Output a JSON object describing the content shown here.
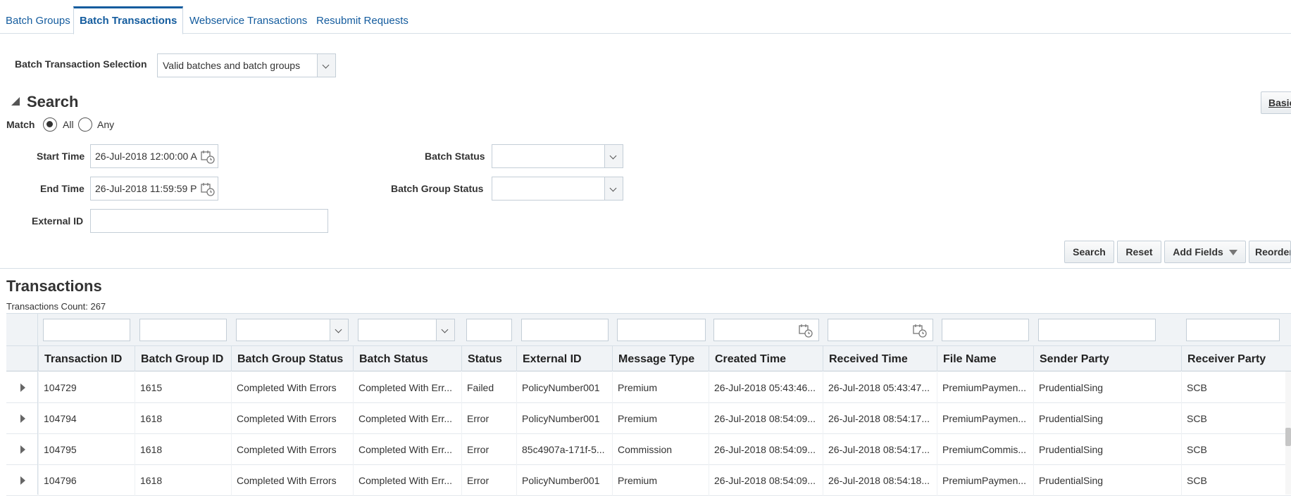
{
  "tabs": [
    {
      "label": "Batch Groups"
    },
    {
      "label": "Batch Transactions"
    },
    {
      "label": "Webservice Transactions"
    },
    {
      "label": "Resubmit Requests"
    }
  ],
  "selection": {
    "label": "Batch Transaction Selection",
    "value": "Valid batches and batch groups"
  },
  "search": {
    "title": "Search",
    "basic_label": "Basic",
    "match_label": "Match",
    "match_all": "All",
    "match_any": "Any",
    "start_time_label": "Start Time",
    "start_time_value": "26-Jul-2018 12:00:00 A",
    "end_time_label": "End Time",
    "end_time_value": "26-Jul-2018 11:59:59 P",
    "external_id_label": "External ID",
    "batch_status_label": "Batch Status",
    "batch_group_status_label": "Batch Group Status",
    "buttons": {
      "search": "Search",
      "reset": "Reset",
      "add_fields": "Add Fields",
      "reorder": "Reorder"
    }
  },
  "transactions": {
    "title": "Transactions",
    "count_text": "Transactions Count: 267",
    "columns": [
      "Transaction ID",
      "Batch Group ID",
      "Batch Group Status",
      "Batch Status",
      "Status",
      "External ID",
      "Message Type",
      "Created Time",
      "Received Time",
      "File Name",
      "Sender Party",
      "Receiver Party"
    ],
    "rows": [
      [
        "104729",
        "1615",
        "Completed With Errors",
        "Completed With Err...",
        "Failed",
        "PolicyNumber001",
        "Premium",
        "26-Jul-2018 05:43:46...",
        "26-Jul-2018 05:43:47...",
        "PremiumPaymen...",
        "PrudentialSing",
        "SCB"
      ],
      [
        "104794",
        "1618",
        "Completed With Errors",
        "Completed With Err...",
        "Error",
        "PolicyNumber001",
        "Premium",
        "26-Jul-2018 08:54:09...",
        "26-Jul-2018 08:54:17...",
        "PremiumPaymen...",
        "PrudentialSing",
        "SCB"
      ],
      [
        "104795",
        "1618",
        "Completed With Errors",
        "Completed With Err...",
        "Error",
        "85c4907a-171f-5...",
        "Commission",
        "26-Jul-2018 08:54:09...",
        "26-Jul-2018 08:54:17...",
        "PremiumCommis...",
        "PrudentialSing",
        "SCB"
      ],
      [
        "104796",
        "1618",
        "Completed With Errors",
        "Completed With Err...",
        "Error",
        "PolicyNumber001",
        "Premium",
        "26-Jul-2018 08:54:09...",
        "26-Jul-2018 08:54:18...",
        "PremiumPaymen...",
        "PrudentialSing",
        "SCB"
      ]
    ]
  }
}
